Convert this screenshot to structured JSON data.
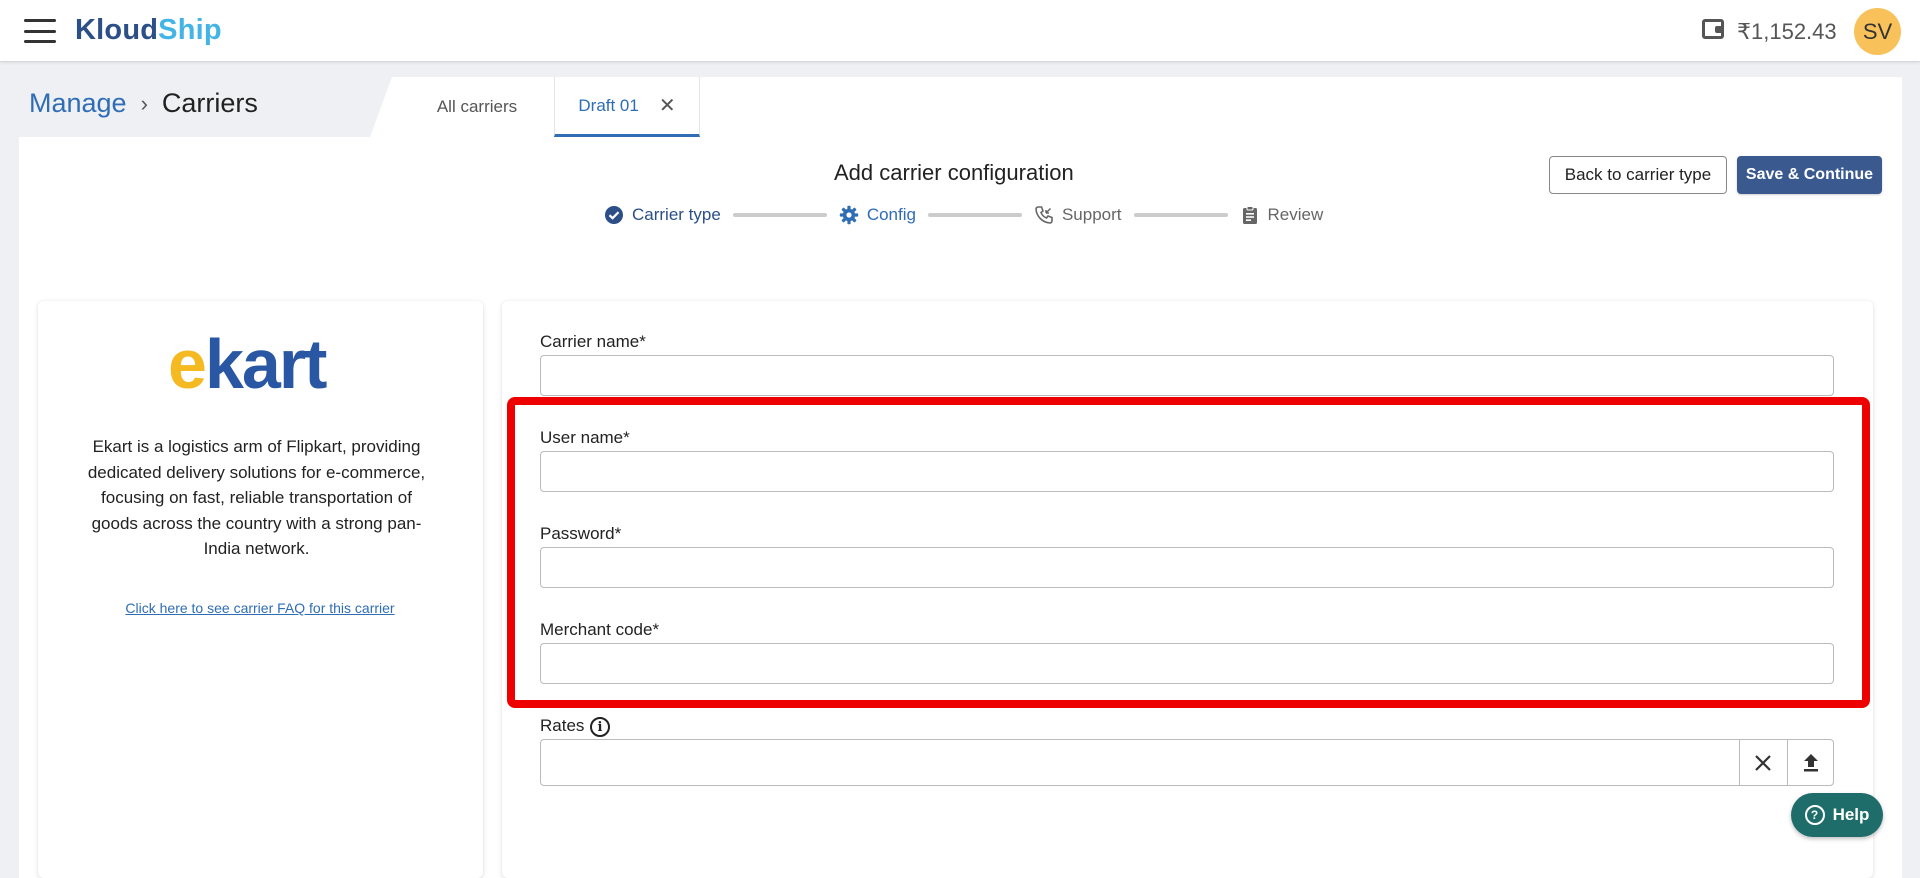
{
  "header": {
    "logo_part1": "Kloud",
    "logo_part2": "Ship",
    "balance": "₹1,152.43",
    "avatar_initials": "SV"
  },
  "breadcrumb": {
    "parent": "Manage",
    "separator": "›",
    "current": "Carriers"
  },
  "tabs": [
    {
      "label": "All carriers",
      "active": false
    },
    {
      "label": "Draft 01",
      "active": true,
      "close": "✕"
    }
  ],
  "page": {
    "title": "Add carrier configuration",
    "back_button": "Back to carrier type",
    "save_button": "Save & Continue"
  },
  "stepper": [
    {
      "label": "Carrier type",
      "state": "done",
      "icon": "check-circle-icon"
    },
    {
      "label": "Config",
      "state": "active",
      "icon": "gear-icon"
    },
    {
      "label": "Support",
      "state": "todo",
      "icon": "phone-icon"
    },
    {
      "label": "Review",
      "state": "todo",
      "icon": "clipboard-icon"
    }
  ],
  "carrier": {
    "logo_text_e": "e",
    "logo_text_rest": "kart",
    "description": "Ekart is a logistics arm of Flipkart, providing dedicated delivery solutions for e-commerce, focusing on fast, reliable transportation of goods across the country with a strong pan-India network.",
    "faq_link": "Click here to see carrier FAQ for this carrier"
  },
  "form": {
    "carrier_name_label": "Carrier name*",
    "carrier_name_value": "",
    "user_name_label": "User name*",
    "user_name_value": "",
    "password_label": "Password*",
    "password_value": "",
    "merchant_code_label": "Merchant code*",
    "merchant_code_value": "",
    "rates_label": "Rates",
    "rates_value": ""
  },
  "help": {
    "label": "Help"
  },
  "colors": {
    "brand_dark": "#2b4f86",
    "brand_light": "#43b4e6",
    "primary_button": "#3a5a8f",
    "highlight": "#ee0000",
    "help_button": "#1e6d6a",
    "ekart_yellow": "#f5b921",
    "ekart_blue": "#2a57a4"
  }
}
